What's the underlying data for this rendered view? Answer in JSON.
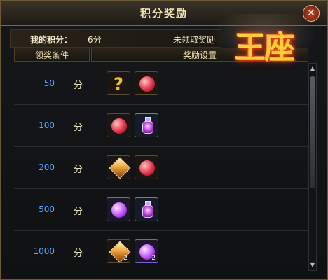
{
  "window": {
    "title": "积分奖励",
    "close_icon": "close-icon"
  },
  "score": {
    "label": "我的积分：",
    "value": "6分",
    "status": "未领取奖励"
  },
  "headers": {
    "condition": "领奖条件",
    "reward": "奖励设置"
  },
  "unit": "分",
  "rows": [
    {
      "points": "50",
      "items": [
        {
          "type": "question-mark-icon",
          "glyph": "?"
        },
        {
          "type": "red-orb-icon"
        }
      ]
    },
    {
      "points": "100",
      "items": [
        {
          "type": "red-orb-icon"
        },
        {
          "type": "purple-potion-icon"
        }
      ]
    },
    {
      "points": "200",
      "items": [
        {
          "type": "orange-gem-icon"
        },
        {
          "type": "red-orb-icon"
        }
      ]
    },
    {
      "points": "500",
      "items": [
        {
          "type": "purple-sphere-icon"
        },
        {
          "type": "purple-potion-icon"
        }
      ]
    },
    {
      "points": "1000",
      "items": [
        {
          "type": "orange-gem-icon",
          "qty": "2"
        },
        {
          "type": "purple-sphere-icon",
          "qty": "2"
        }
      ]
    }
  ],
  "logo": {
    "text": "王座"
  },
  "colors": {
    "points": "#58a6ff",
    "gold": "#f0e1b2"
  }
}
